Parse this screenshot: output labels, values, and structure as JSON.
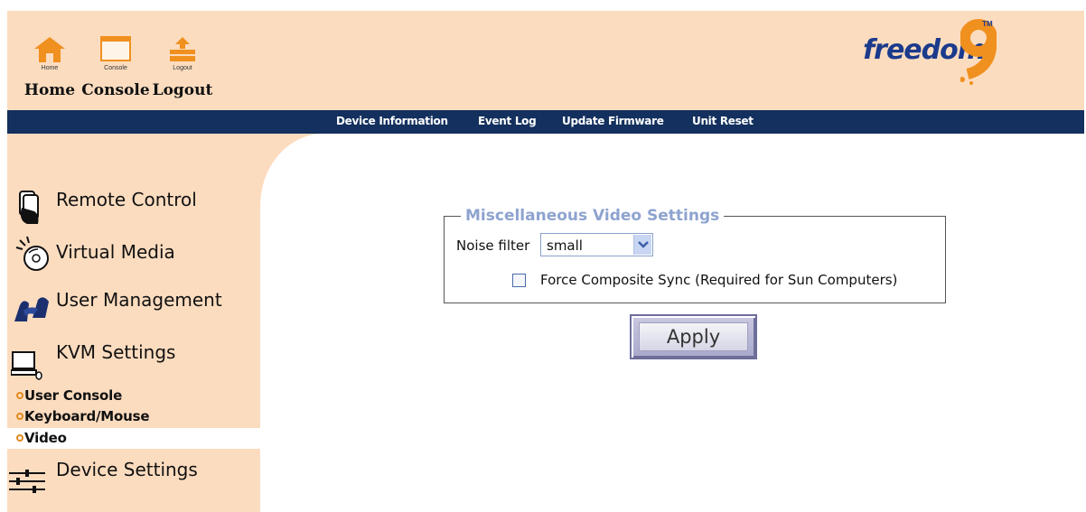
{
  "header": {
    "nav": [
      {
        "small": "Home",
        "label": "Home",
        "icon": "home-icon"
      },
      {
        "small": "Console",
        "label": "Console",
        "icon": "console-icon"
      },
      {
        "small": "Logout",
        "label": "Logout",
        "icon": "logout-icon"
      }
    ],
    "logo": {
      "text": "freedom",
      "mark": "9",
      "tm": "TM"
    }
  },
  "tabs": [
    "Device Information",
    "Event Log",
    "Update Firmware",
    "Unit Reset"
  ],
  "sidebar": {
    "items": [
      {
        "label": "Remote Control",
        "icon": "remote-control-icon"
      },
      {
        "label": "Virtual Media",
        "icon": "virtual-media-icon"
      },
      {
        "label": "User Management",
        "icon": "user-management-icon"
      },
      {
        "label": "KVM Settings",
        "icon": "kvm-settings-icon"
      }
    ],
    "subitems": [
      "User Console",
      "Keyboard/Mouse",
      "Video"
    ],
    "active_subitem": "Video",
    "bottom_item": {
      "label": "Device Settings",
      "icon": "device-settings-icon"
    }
  },
  "main": {
    "section_title": "Miscellaneous Video Settings",
    "noise_filter_label": "Noise filter",
    "noise_filter_value": "small",
    "composite_sync_label": "Force Composite Sync (Required for Sun Computers)",
    "composite_sync_checked": false,
    "apply_label": "Apply"
  },
  "colors": {
    "header_bg": "#fcdcbf",
    "nav_bar": "#13305e",
    "legend": "#8ea3cf",
    "brand_blue": "#1b3a8c",
    "brand_orange": "#f08a1e"
  }
}
